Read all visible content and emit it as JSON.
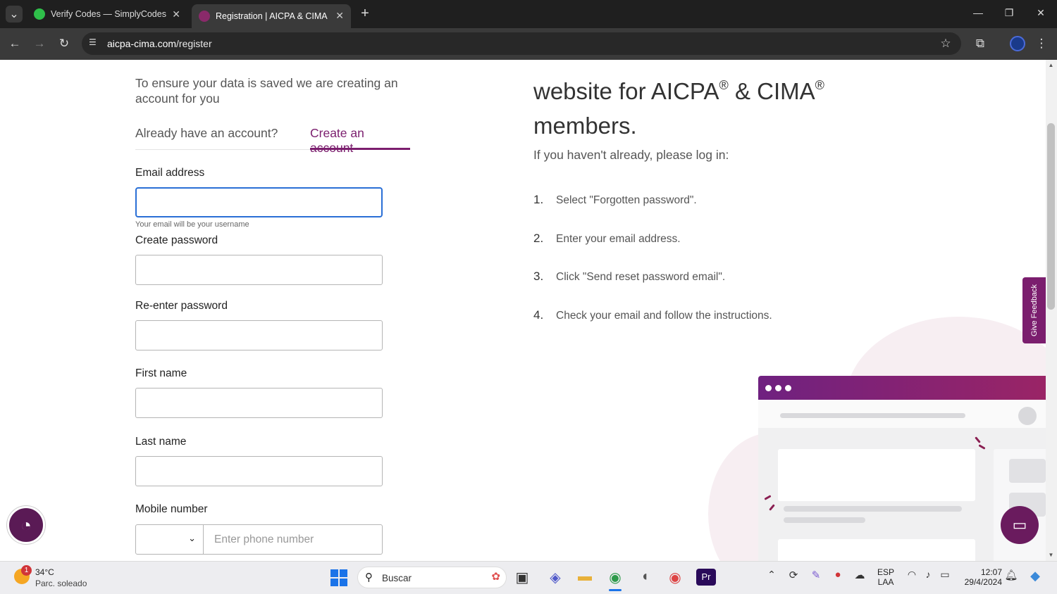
{
  "browser": {
    "tabs": [
      {
        "title": "Verify Codes — SimplyCodes",
        "active": false
      },
      {
        "title": "Registration | AICPA & CIMA",
        "active": true
      }
    ],
    "new_tab": "+",
    "url_host": "aicpa-cima.com",
    "url_path": "/register"
  },
  "form": {
    "intro": "To ensure your data is saved we are creating an account for you",
    "tab_login": "Already have an account?",
    "tab_create": "Create an account",
    "email_label": "Email address",
    "email_hint": "Your email will be your username",
    "password_label": "Create password",
    "reenter_label": "Re-enter password",
    "first_name_label": "First name",
    "last_name_label": "Last name",
    "mobile_label": "Mobile number",
    "phone_placeholder": "Enter phone number"
  },
  "info": {
    "heading_prefix": "website for AICPA",
    "heading_mid": " & CIMA",
    "reg": "®",
    "heading_suffix": "members.",
    "subtext": "If you haven't already, please log in:",
    "steps": [
      {
        "num": "1.",
        "text": "Select \"Forgotten password\"."
      },
      {
        "num": "2.",
        "text": "Enter your email address."
      },
      {
        "num": "3.",
        "text": "Click \"Send reset password email\"."
      },
      {
        "num": "4.",
        "text": "Check your email and follow the instructions."
      }
    ]
  },
  "feedback": "Give Feedback",
  "taskbar": {
    "weather_temp": "34°C",
    "weather_desc": "Parc. soleado",
    "weather_badge": "1",
    "search": "Buscar",
    "lang_top": "ESP",
    "lang_bottom": "LAA",
    "time": "12:07",
    "date": "29/4/2024"
  },
  "colors": {
    "accent": "#7b1e6e",
    "focus": "#2a6fd6"
  }
}
